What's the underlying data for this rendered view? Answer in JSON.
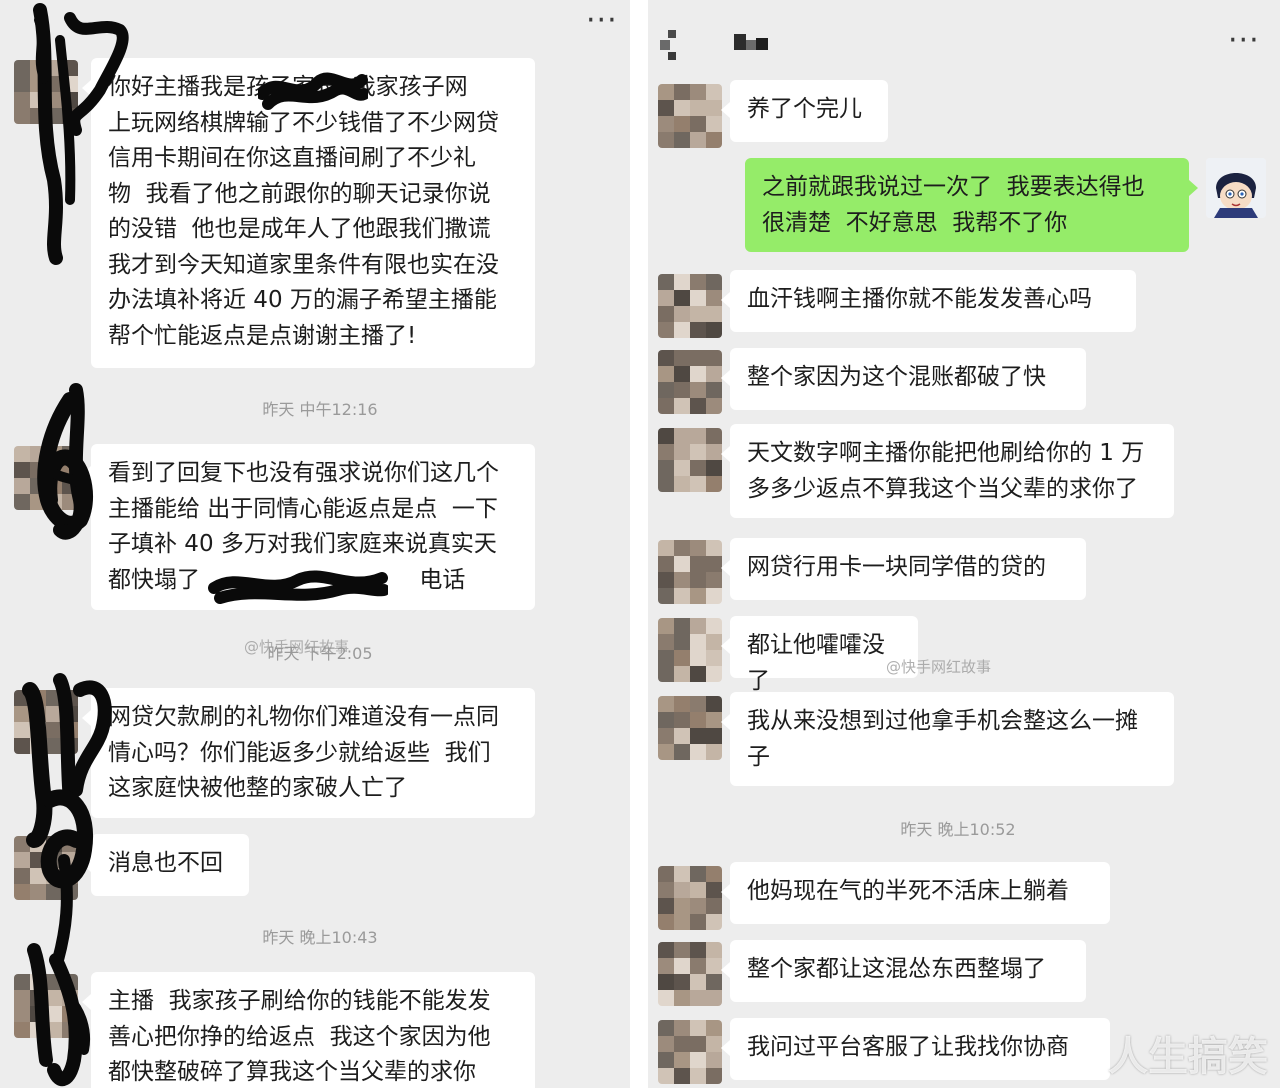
{
  "left_chat": {
    "more_label": "···",
    "messages": [
      {
        "type": "received",
        "text": "你好主播我是孩子家长  我家孩子网\n上玩网络棋牌输了不少钱借了不少网贷\n信用卡期间在你这直播间刷了不少礼\n物  我看了他之前跟你的聊天记录你说\n的没错  他也是成年人了他跟我们撒谎\n我才到今天知道家里条件有限也实在没\n办法填补将近 40 万的漏子希望主播能\n帮个忙能返点是点谢谢主播了!"
      },
      {
        "type": "time",
        "text": "昨天 中午12:16"
      },
      {
        "type": "received",
        "text": "看到了回复下也没有强求说你们这几个\n主播能给 出于同情心能返点是点  一下\n子填补 40 多万对我们家庭来说真实天\n都快塌了                              电话"
      },
      {
        "type": "time",
        "text": "昨天 下午2:05"
      },
      {
        "type": "received",
        "text": "网贷欠款刷的礼物你们难道没有一点同\n情心吗？你们能返多少就给返些  我们\n这家庭快被他整的家破人亡了"
      },
      {
        "type": "received",
        "text": "消息也不回"
      },
      {
        "type": "time",
        "text": "昨天 晚上10:43"
      },
      {
        "type": "received",
        "text": "主播  我家孩子刷给你的钱能不能发发\n善心把你挣的给返点  我这个家因为他\n都快整破碎了算我这个当父辈的求你"
      }
    ]
  },
  "right_chat": {
    "more_label": "···",
    "messages": [
      {
        "type": "received",
        "text": "养了个完儿"
      },
      {
        "type": "sent",
        "text": "之前就跟我说过一次了  我要表达得也\n很清楚  不好意思  我帮不了你"
      },
      {
        "type": "received",
        "text": "血汗钱啊主播你就不能发发善心吗"
      },
      {
        "type": "received",
        "text": "整个家因为这个混账都破了快"
      },
      {
        "type": "received",
        "text": "天文数字啊主播你能把他刷给你的 1 万\n多多少返点不算我这个当父辈的求你了"
      },
      {
        "type": "received",
        "text": "网贷行用卡一块同学借的贷的"
      },
      {
        "type": "received",
        "text": "都让他嚯嚯没了"
      },
      {
        "type": "received",
        "text": "我从来没想到过他拿手机会整这么一摊\n子"
      },
      {
        "type": "time",
        "text": "昨天 晚上10:52"
      },
      {
        "type": "received",
        "text": "他妈现在气的半死不活床上躺着"
      },
      {
        "type": "received",
        "text": "整个家都让这混怂东西整塌了"
      },
      {
        "type": "received",
        "text": "我问过平台客服了让我找你协商"
      }
    ]
  },
  "watermarks": {
    "left_small": "@快手网红故事",
    "right_small": "@快手网红故事",
    "bottom_right": "人生搞笑"
  },
  "colors": {
    "chat_bg": "#ededed",
    "sent_bubble": "#95ec69",
    "received_bubble": "#ffffff",
    "timestamp": "#9a9a9a"
  }
}
